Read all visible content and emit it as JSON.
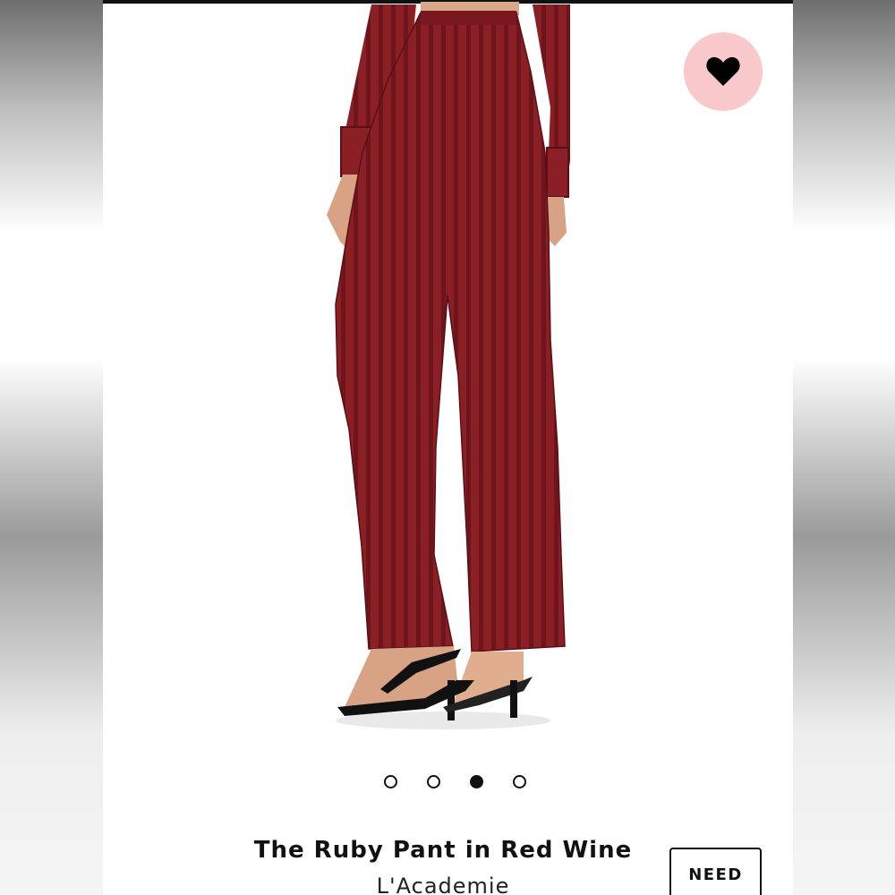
{
  "product": {
    "title": "The Ruby Pant in Red Wine",
    "brand": "L'Academie",
    "need_label": "NEED",
    "garment_color": "#8a1f26"
  },
  "favorite": {
    "icon": "heart-icon",
    "bg_color": "#f9c8cb"
  },
  "carousel": {
    "count": 4,
    "active_index": 2
  }
}
